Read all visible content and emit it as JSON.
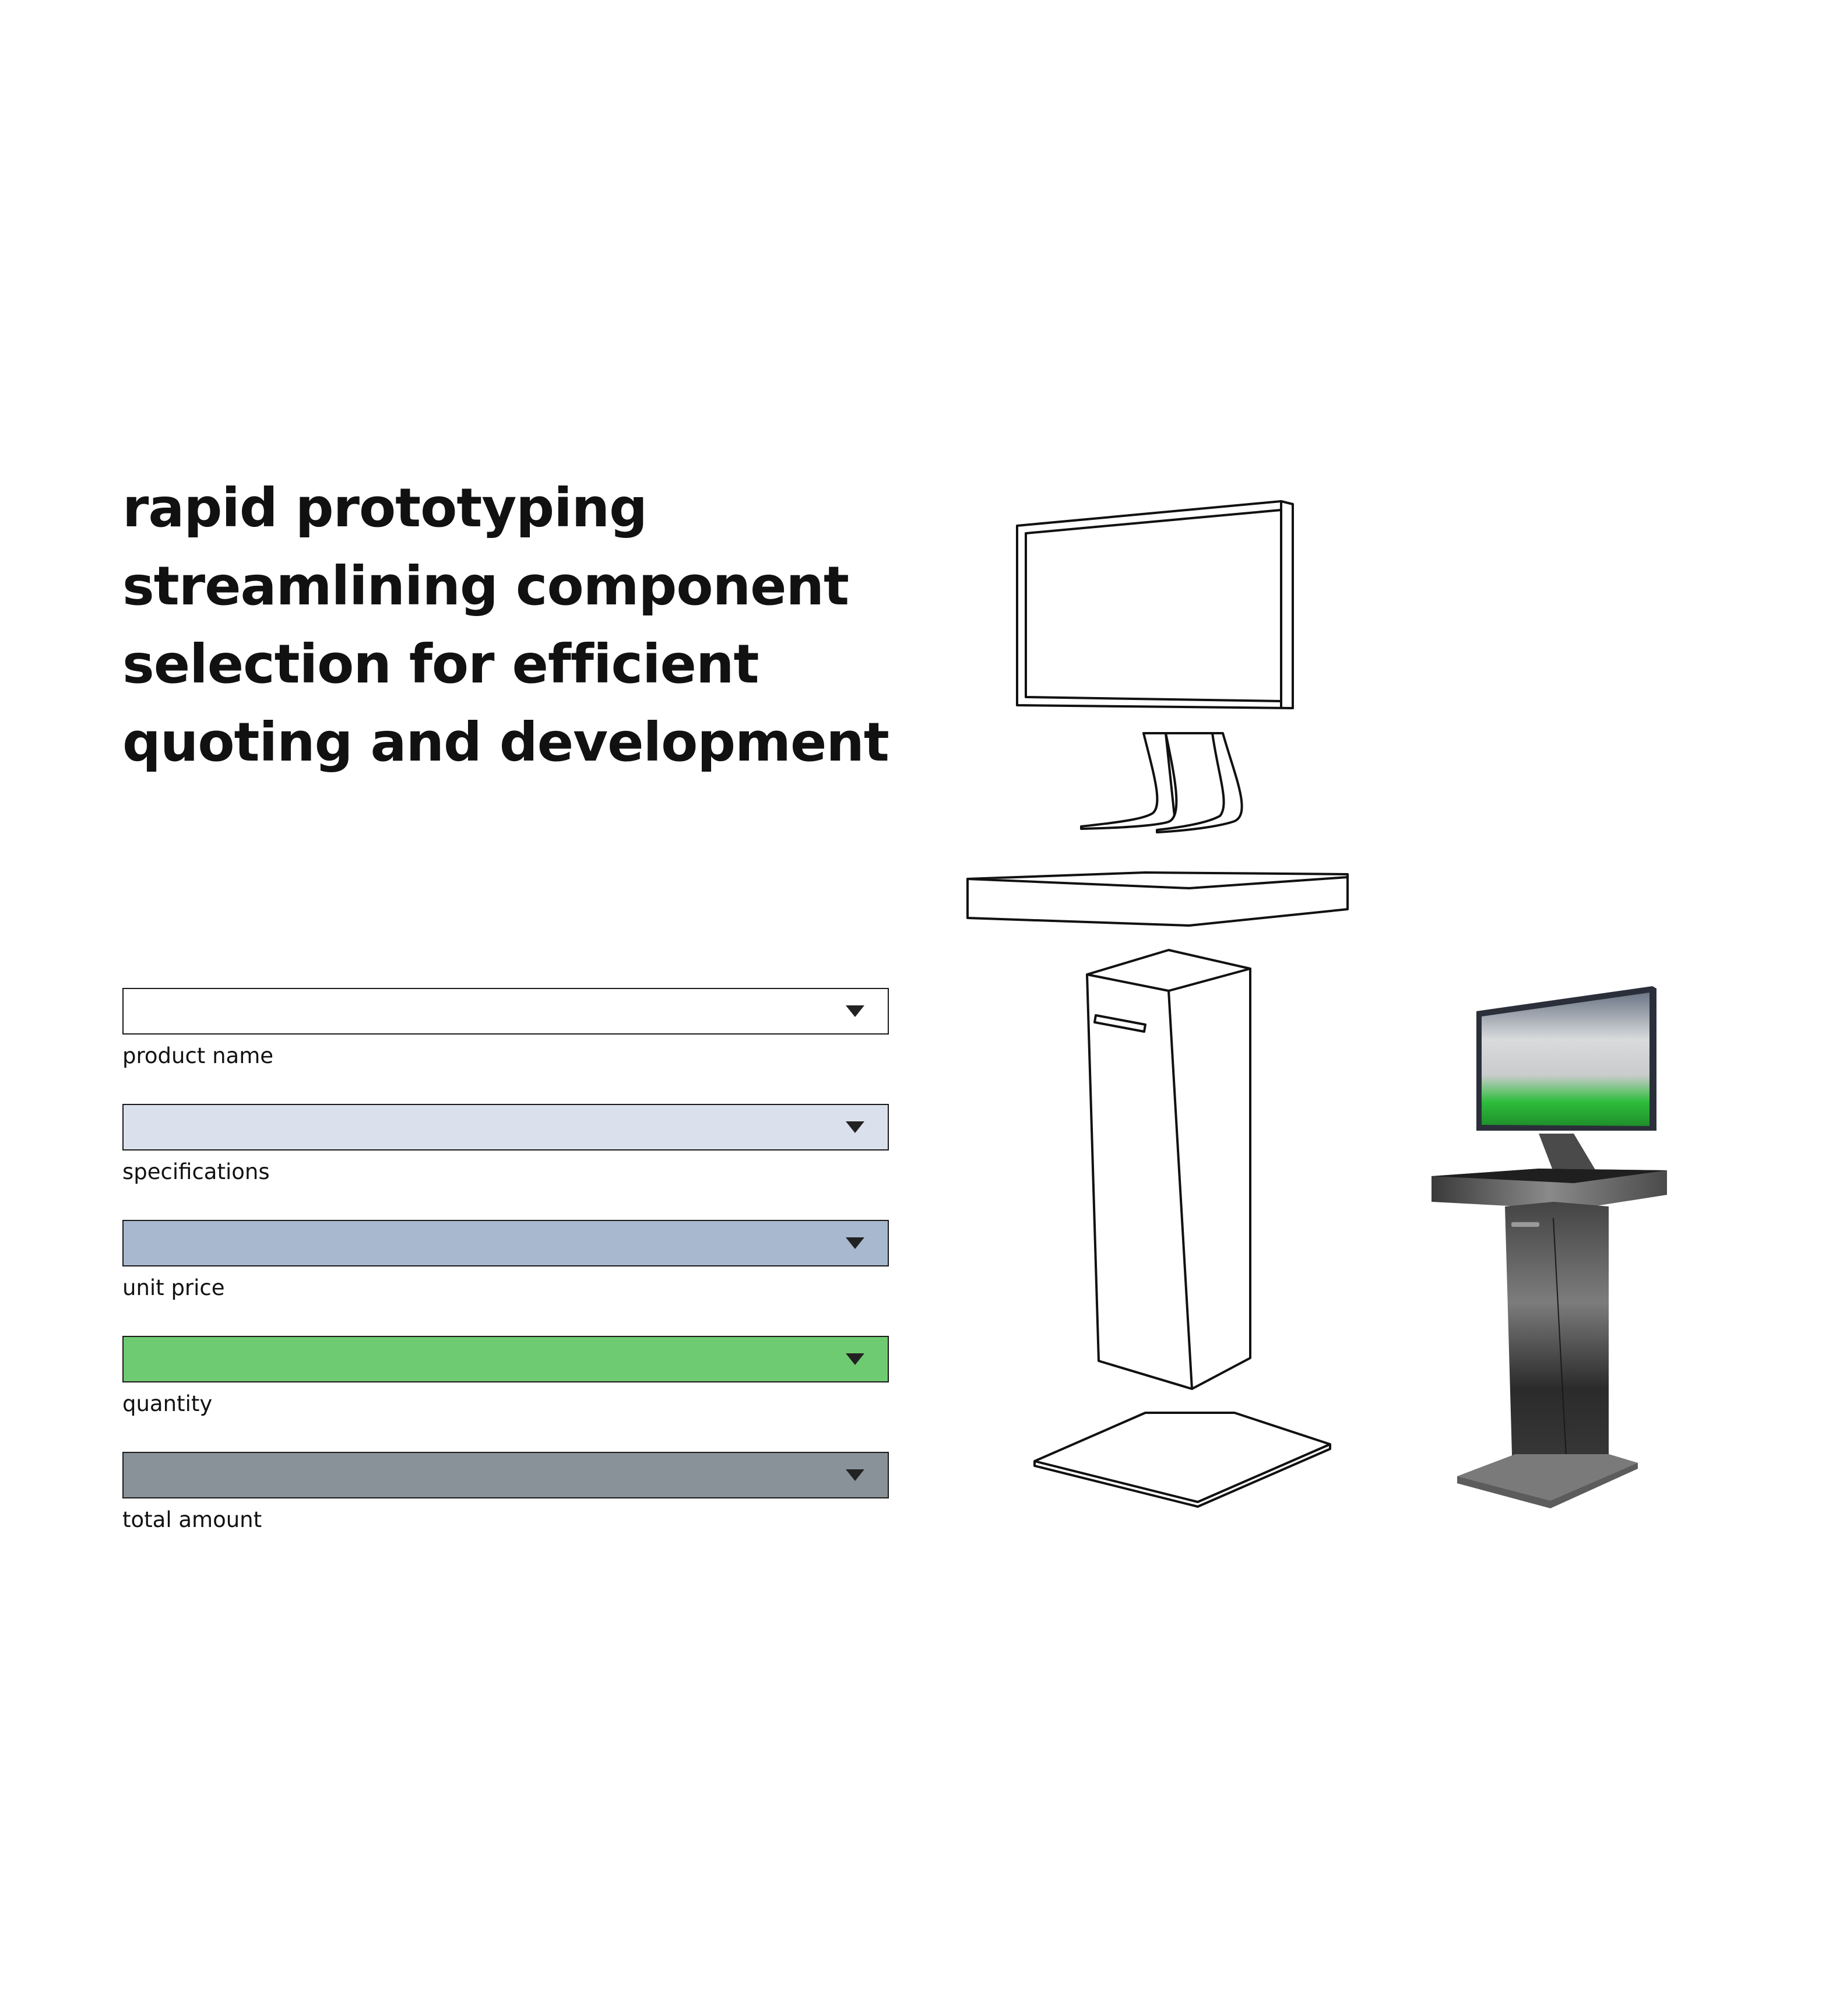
{
  "headline": {
    "lines": [
      "rapid prototyping",
      "streamlining component",
      "selection for efficient",
      "quoting and development"
    ]
  },
  "form": {
    "fields": [
      {
        "label": "product name",
        "value": "",
        "color": "#ffffff"
      },
      {
        "label": "specifications",
        "value": "",
        "color": "#dbe1ec"
      },
      {
        "label": "unit price",
        "value": "",
        "color": "#a8b9cf"
      },
      {
        "label": "quantity",
        "value": "",
        "color": "#6fcb72"
      },
      {
        "label": "total amount",
        "value": "",
        "color": "#8a9299"
      }
    ]
  },
  "colors": {
    "text": "#111111",
    "outline": "#1a1a1a",
    "accent_green": "#2ebd3c",
    "kiosk_dark": "#2e2e2e"
  },
  "icons": {
    "dropdown": "caret-down-icon"
  }
}
